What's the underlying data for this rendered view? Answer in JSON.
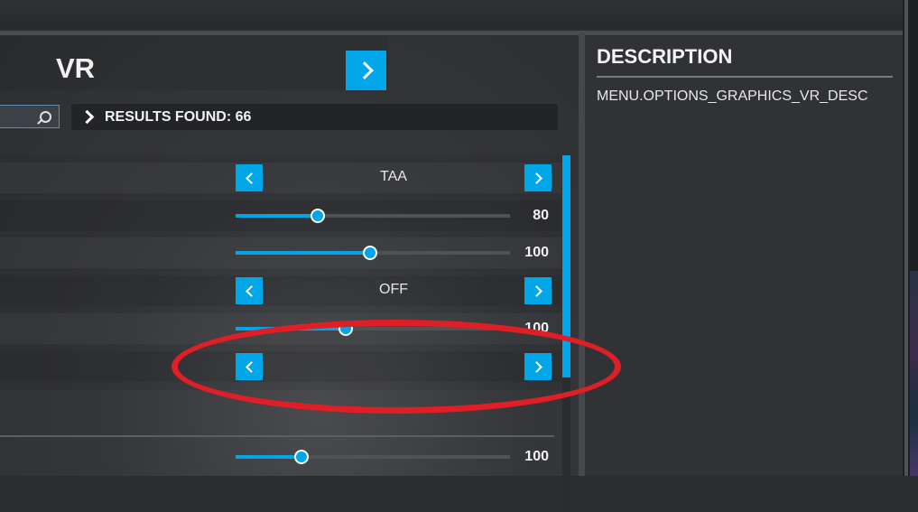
{
  "header": {
    "title": "VR",
    "next_icon": "chevron-right-icon"
  },
  "search": {
    "placeholder": "",
    "value": "",
    "icon": "search-icon"
  },
  "results": {
    "label": "RESULTS FOUND: 66"
  },
  "settings": [
    {
      "type": "selector",
      "value": "TAA"
    },
    {
      "type": "slider",
      "value": "80",
      "fraction": 0.3
    },
    {
      "type": "slider",
      "value": "100",
      "fraction": 0.49
    },
    {
      "type": "selector",
      "value": "OFF"
    },
    {
      "type": "slider",
      "value": "100",
      "fraction": 0.4
    },
    {
      "type": "selector",
      "value": ""
    },
    {
      "type": "slider",
      "value": "100",
      "fraction": 0.24
    }
  ],
  "description": {
    "title": "DESCRIPTION",
    "text": "MENU.OPTIONS_GRAPHICS_VR_DESC"
  },
  "colors": {
    "accent": "#00a6e8",
    "annotation": "#e01e25",
    "background": "#2b2d31"
  }
}
